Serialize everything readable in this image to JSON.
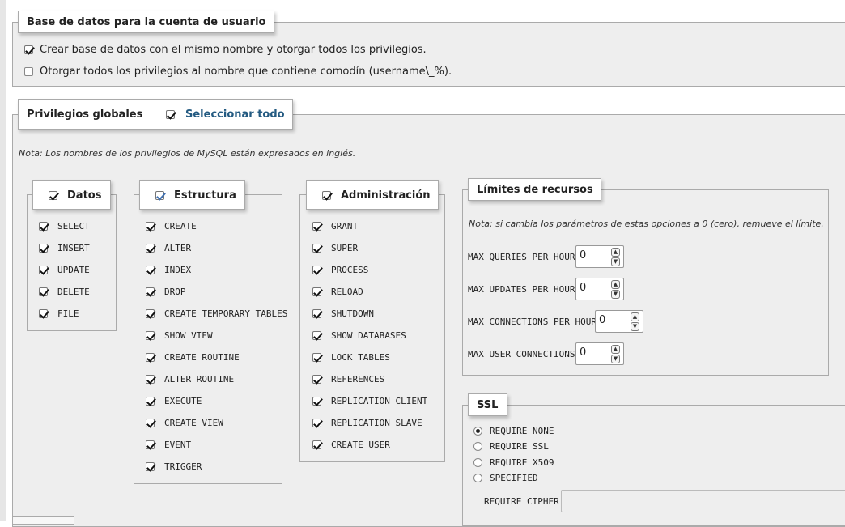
{
  "db_section": {
    "legend": "Base de datos para la cuenta de usuario",
    "options": [
      {
        "label": "Crear base de datos con el mismo nombre y otorgar todos los privilegios.",
        "checked": true
      },
      {
        "label": "Otorgar todos los privilegios al nombre que contiene comodín (username\\_%).",
        "checked": false
      }
    ]
  },
  "global_privileges": {
    "legend": "Privilegios globales",
    "select_all": "Seleccionar todo",
    "note": "Nota: Los nombres de los privilegios de MySQL están expresados en inglés.",
    "groups": {
      "datos": {
        "title": "Datos",
        "items": [
          "SELECT",
          "INSERT",
          "UPDATE",
          "DELETE",
          "FILE"
        ]
      },
      "estructura": {
        "title": "Estructura",
        "items": [
          "CREATE",
          "ALTER",
          "INDEX",
          "DROP",
          "CREATE TEMPORARY TABLES",
          "SHOW VIEW",
          "CREATE ROUTINE",
          "ALTER ROUTINE",
          "EXECUTE",
          "CREATE VIEW",
          "EVENT",
          "TRIGGER"
        ]
      },
      "administracion": {
        "title": "Administración",
        "items": [
          "GRANT",
          "SUPER",
          "PROCESS",
          "RELOAD",
          "SHUTDOWN",
          "SHOW DATABASES",
          "LOCK TABLES",
          "REFERENCES",
          "REPLICATION CLIENT",
          "REPLICATION SLAVE",
          "CREATE USER"
        ]
      }
    }
  },
  "limits": {
    "legend": "Límites de recursos",
    "note": "Nota: si cambia los parámetros de estas opciones a 0 (cero), remueve el límite.",
    "fields": [
      {
        "label": "MAX QUERIES PER HOUR",
        "value": "0"
      },
      {
        "label": "MAX UPDATES PER HOUR",
        "value": "0"
      },
      {
        "label": "MAX CONNECTIONS PER HOUR",
        "value": "0"
      },
      {
        "label": "MAX USER_CONNECTIONS",
        "value": "0"
      }
    ]
  },
  "ssl": {
    "legend": "SSL",
    "options": [
      {
        "label": "REQUIRE NONE",
        "selected": true
      },
      {
        "label": "REQUIRE SSL",
        "selected": false
      },
      {
        "label": "REQUIRE X509",
        "selected": false
      },
      {
        "label": "SPECIFIED",
        "selected": false
      }
    ],
    "cipher_label": "REQUIRE CIPHER",
    "cipher_value": ""
  },
  "colors": {
    "link": "#235a81",
    "panel": "#eeeeee",
    "border": "#aaaaaa"
  }
}
